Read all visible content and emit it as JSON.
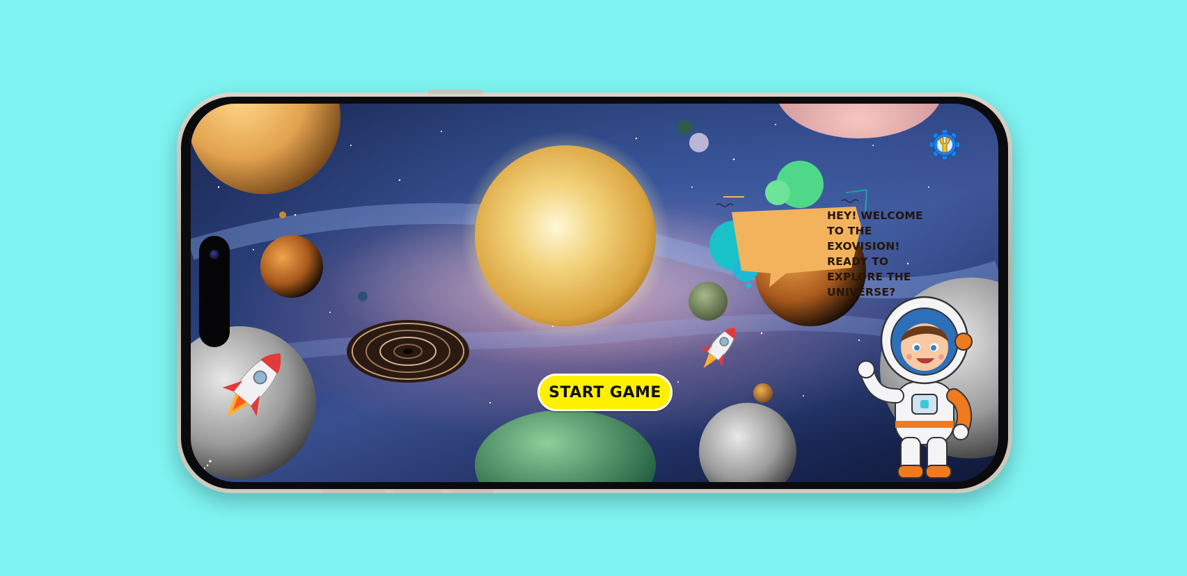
{
  "app": {
    "greeting": "Hey! Welcome to the Exovision! Ready to explore the Universe?",
    "start_label": "START GAME"
  },
  "icons": {
    "settings": "gear-wrench-icon"
  },
  "colors": {
    "background": "#7ef3f1",
    "start_button": "#fff000",
    "speech_bubble": "#f2b35c",
    "settings_gear": "#1e7ee8",
    "settings_wrench": "#f2c230"
  }
}
